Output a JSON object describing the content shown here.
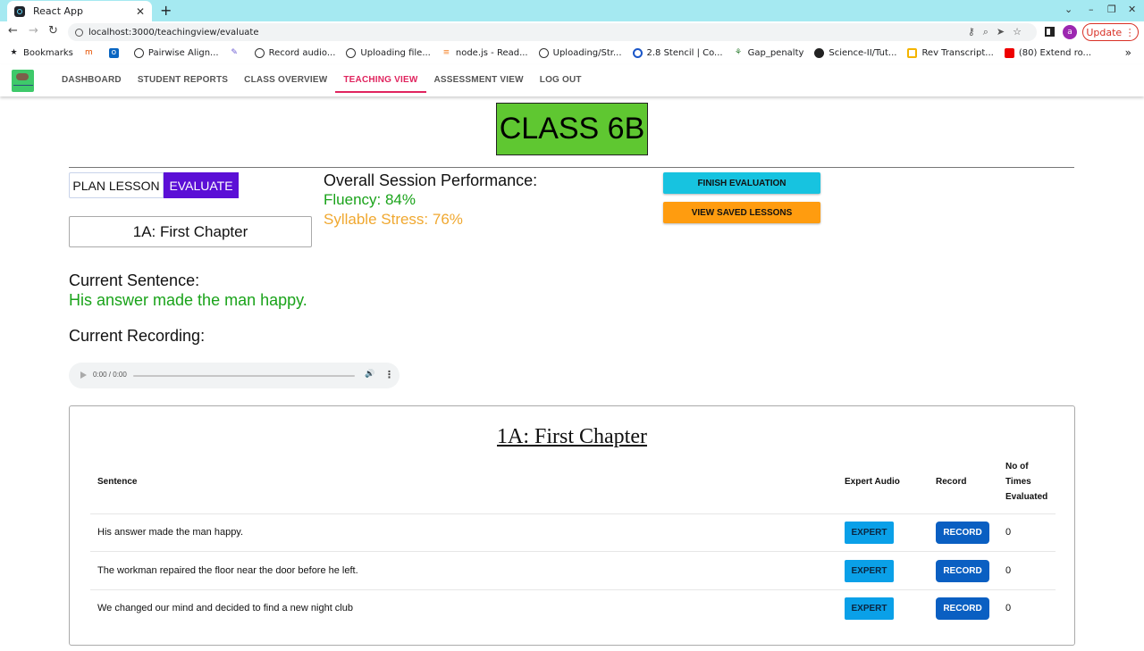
{
  "browser": {
    "tab_title": "React App",
    "url": "localhost:3000/teachingview/evaluate",
    "update_label": "Update",
    "profile_initial": "a",
    "bookmarks": [
      "Bookmarks",
      "Pairwise Align...",
      "Record audio...",
      "Uploading file...",
      "node.js - Read...",
      "Uploading/Str...",
      "2.8 Stencil | Co...",
      "Gap_penalty",
      "Science-II/Tut...",
      "Rev Transcript...",
      "(80) Extend ro..."
    ]
  },
  "nav": {
    "items": [
      "DASHBOARD",
      "STUDENT REPORTS",
      "CLASS OVERVIEW",
      "TEACHING VIEW",
      "ASSESSMENT VIEW",
      "LOG OUT"
    ],
    "active": "TEACHING VIEW"
  },
  "main": {
    "class_name": "CLASS 6B",
    "mode_plan": "PLAN LESSON",
    "mode_evaluate": "EVALUATE",
    "chapter": "1A: First Chapter",
    "performance_title": "Overall Session Performance:",
    "fluency": "Fluency: 84%",
    "syllable_stress": "Syllable Stress: 76%",
    "finish_label": "FINISH EVALUATION",
    "saved_label": "VIEW SAVED LESSONS",
    "current_sentence_label": "Current Sentence:",
    "current_sentence": "His answer made the man happy.",
    "current_recording_label": "Current Recording:",
    "audio_time": "0:00 / 0:00"
  },
  "table": {
    "title": "1A: First Chapter",
    "headers": {
      "sentence": "Sentence",
      "expert": "Expert Audio",
      "record": "Record",
      "times_1": "No of",
      "times_2": "Times",
      "times_3": "Evaluated"
    },
    "rows": [
      {
        "sentence": "His answer made the man happy.",
        "expert": "EXPERT",
        "record": "RECORD",
        "count": "0"
      },
      {
        "sentence": "The workman repaired the floor near the door before he left.",
        "expert": "EXPERT",
        "record": "RECORD",
        "count": "0"
      },
      {
        "sentence": "We changed our mind and decided to find a new night club",
        "expert": "EXPERT",
        "record": "RECORD",
        "count": "0"
      }
    ]
  },
  "colors": {
    "accent": "#e0245e",
    "evaluate": "#5b0fd6",
    "fluency": "#1aa31a",
    "stress": "#f0a830",
    "class_banner": "#5fc731"
  }
}
